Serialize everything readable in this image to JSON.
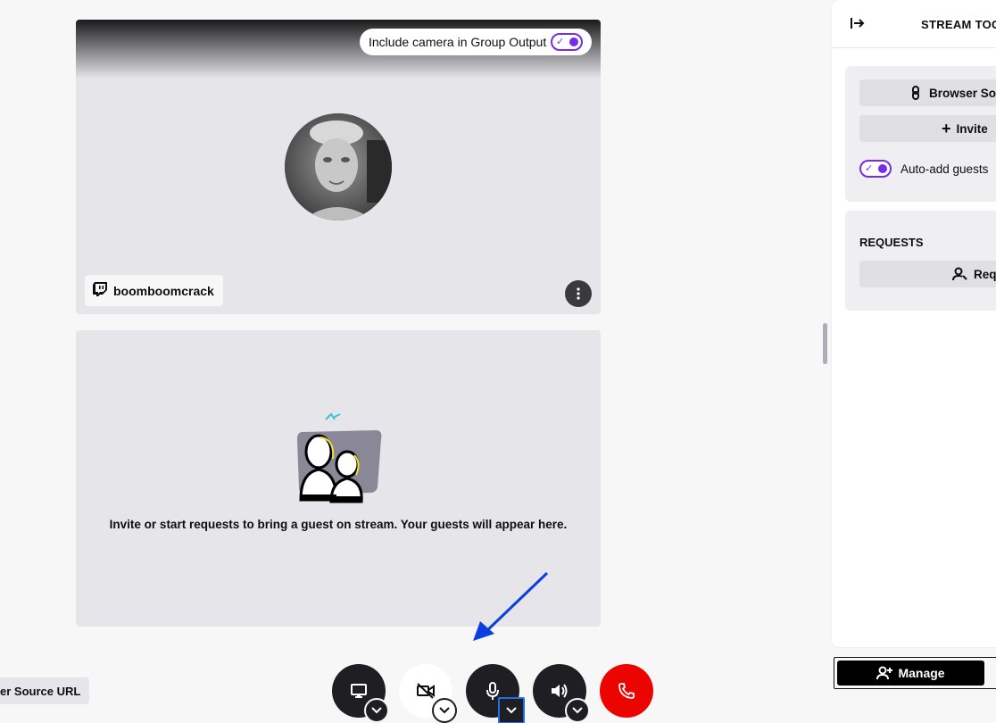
{
  "camera_card": {
    "toggle_label": "Include camera in Group Output",
    "toggle_on": true,
    "username": "boomboomcrack"
  },
  "guest_card": {
    "message": "Invite or start requests to bring a guest on stream. Your guests will appear here."
  },
  "controls": {
    "buttons": [
      "monitor-icon",
      "camera-off-icon",
      "microphone-icon",
      "speaker-icon",
      "end-call-icon"
    ]
  },
  "left_partial_button": "er Source URL",
  "side_panel": {
    "title": "STREAM TOG",
    "browser_source_label": "Browser Sou",
    "invite_label": "Invite",
    "auto_add_label": "Auto-add guests",
    "auto_add_on": true,
    "requests_title": "REQUESTS",
    "requests_button_label": "Requ"
  },
  "manage_button": "Manage",
  "colors": {
    "accent": "#772ce8",
    "end_call": "#eb0400",
    "arrow": "#0b3fe0"
  }
}
